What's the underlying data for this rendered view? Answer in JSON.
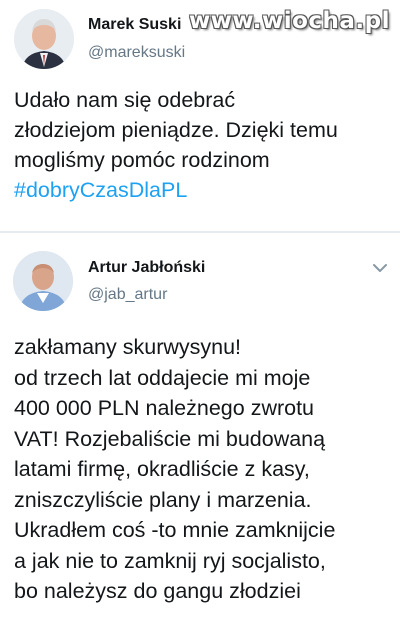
{
  "watermark": "www.wiocha.pl",
  "tweets": [
    {
      "name": "Marek Suski",
      "handle": "@mareksuski",
      "text_lines": [
        "Udało nam się odebrać",
        "złodziejom pieniądze. Dzięki temu",
        "mogliśmy pomóc rodzinom"
      ],
      "hashtag": "#dobryCzasDlaPL"
    },
    {
      "name": "Artur Jabłoński",
      "handle": "@jab_artur",
      "text": "zakłamany skurwysynu!\nod trzech lat oddajecie mi moje\n400 000 PLN należnego zwrotu\nVAT! Rozjebaliście mi budowaną\nlatami firmę, okradliście z kasy,\nzniszczyliście plany i marzenia.\nUkradłem coś -to mnie zamknijcie\na jak nie to zamknij ryj socjalisto,\nbo należysz do gangu złodziei"
    }
  ],
  "colors": {
    "hashtag": "#1da1f2",
    "handle": "#657786",
    "text": "#14171a"
  }
}
